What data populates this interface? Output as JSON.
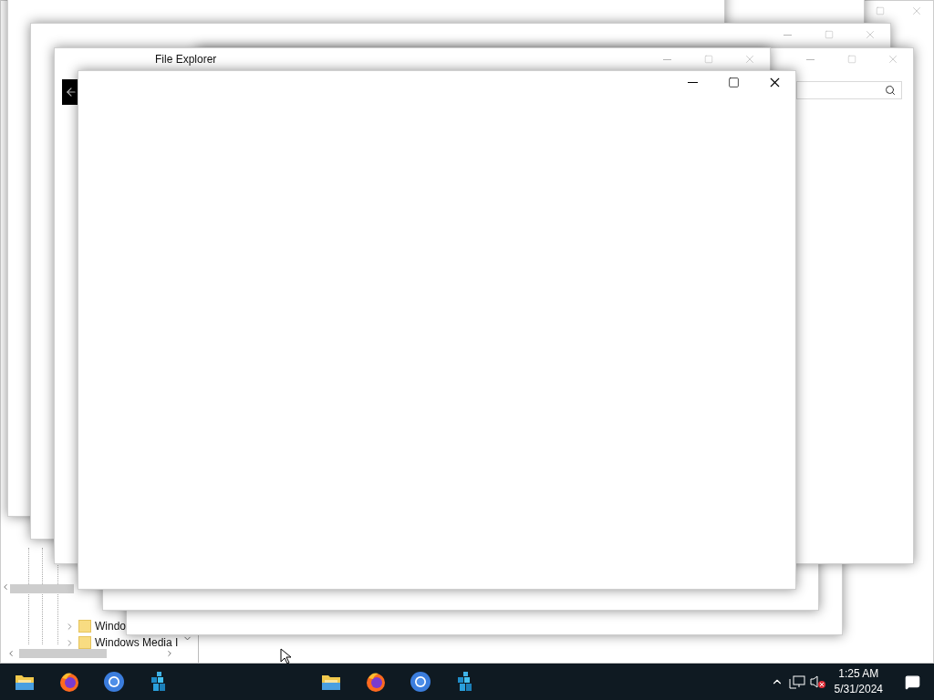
{
  "background_window": {
    "active": false,
    "tree_items": [
      {
        "label": "Windo",
        "expanded": false
      },
      {
        "label": "Windows Media I",
        "expanded": false
      }
    ]
  },
  "windows": [
    {
      "kind": "window"
    },
    {
      "kind": "window"
    },
    {
      "kind": "window"
    },
    {
      "kind": "window"
    },
    {
      "kind": "window",
      "active": false
    },
    {
      "kind": "window",
      "active": false,
      "search_box": true
    },
    {
      "kind": "window",
      "active": false,
      "title": "File Explorer",
      "back_button": true
    },
    {
      "kind": "window",
      "active": true
    }
  ],
  "taskbar": {
    "apps": [
      {
        "kind": "folder"
      },
      {
        "kind": "firefox"
      },
      {
        "kind": "chromium"
      },
      {
        "kind": "cubes"
      },
      {
        "kind": "folder"
      },
      {
        "kind": "firefox"
      },
      {
        "kind": "chromium"
      },
      {
        "kind": "cubes"
      }
    ],
    "clock": {
      "time": "1:25 AM",
      "date": "5/31/2024"
    }
  }
}
